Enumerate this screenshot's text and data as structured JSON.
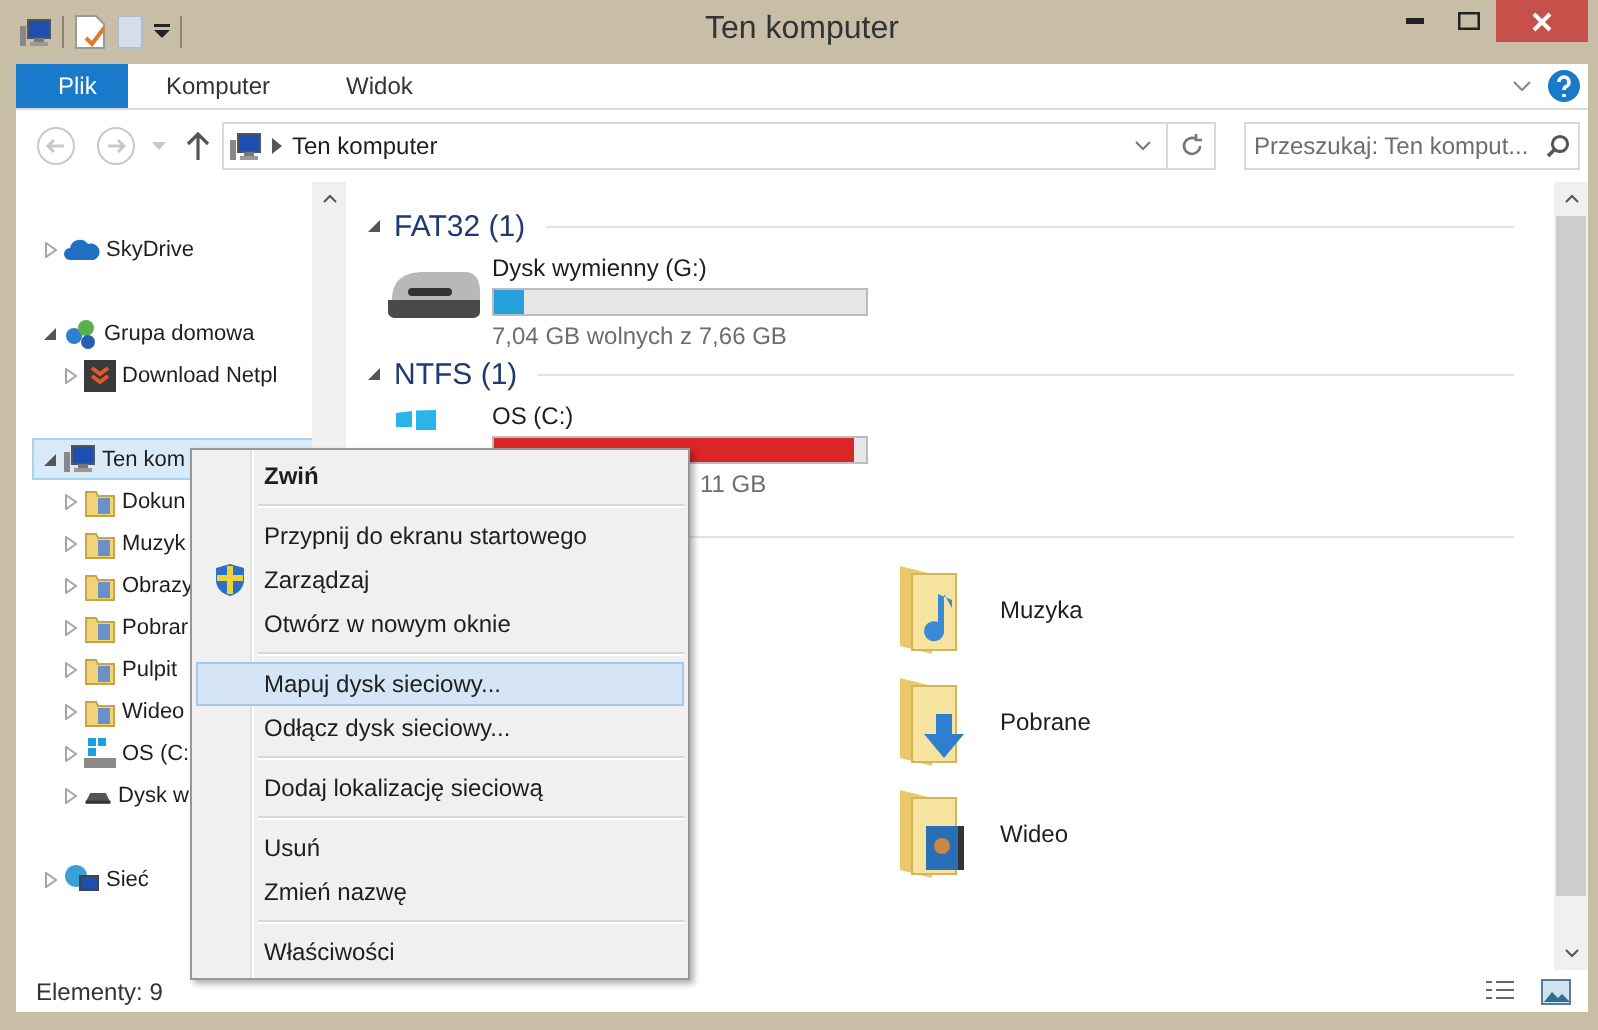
{
  "window": {
    "title": "Ten komputer"
  },
  "ribbon": {
    "tabs": [
      {
        "label": "Plik",
        "kind": "file",
        "selected": false
      },
      {
        "label": "Komputer",
        "kind": "tab",
        "selected": false
      },
      {
        "label": "Widok",
        "kind": "tab",
        "selected": false
      }
    ]
  },
  "address_bar": {
    "path": [
      "Ten komputer"
    ]
  },
  "search": {
    "placeholder": "Przeszukaj: Ten komput..."
  },
  "navigation": {
    "items": [
      {
        "label": "SkyDrive",
        "kind": "cloud",
        "expanded": false,
        "selected": false
      },
      {
        "label": "Grupa domowa",
        "kind": "homegroup",
        "expanded": true,
        "selected": false,
        "children": [
          {
            "label": "Download Netpl",
            "kind": "app",
            "expanded": false,
            "selected": false
          }
        ]
      },
      {
        "label": "Ten kom",
        "kind": "computer",
        "expanded": true,
        "selected": true,
        "children": [
          {
            "label": "Dokun",
            "kind": "folder",
            "expanded": false,
            "selected": false
          },
          {
            "label": "Muzyk",
            "kind": "folder",
            "expanded": false,
            "selected": false
          },
          {
            "label": "Obrazy",
            "kind": "folder",
            "expanded": false,
            "selected": false
          },
          {
            "label": "Pobrar",
            "kind": "folder",
            "expanded": false,
            "selected": false
          },
          {
            "label": "Pulpit",
            "kind": "folder",
            "expanded": false,
            "selected": false
          },
          {
            "label": "Wideo",
            "kind": "folder",
            "expanded": false,
            "selected": false
          },
          {
            "label": "OS (C:",
            "kind": "system",
            "expanded": false,
            "selected": false
          },
          {
            "label": "Dysk w",
            "kind": "removable",
            "expanded": false,
            "selected": false
          }
        ]
      },
      {
        "label": "Sieć",
        "kind": "network",
        "expanded": false,
        "selected": false
      }
    ]
  },
  "content": {
    "groups": [
      {
        "title": "FAT32 (1)",
        "expanded": true,
        "drives": [
          {
            "name": "Dysk wymienny (G:)",
            "kind": "removable",
            "level": 0.08,
            "free_space": "7,04 GB wolnych z 7,66 GB",
            "start_hidden": false
          }
        ]
      },
      {
        "title": "NTFS (1)",
        "expanded": true,
        "drives": [
          {
            "name": "OS (C:)",
            "kind": "system",
            "level": 0.97,
            "free_space": "11 GB",
            "start_hidden": true
          }
        ]
      }
    ],
    "folders": [
      {
        "name": "Muzyka",
        "kind": "music"
      },
      {
        "name": "Pobrane",
        "kind": "downloads"
      },
      {
        "name": "Wideo",
        "kind": "video"
      }
    ]
  },
  "context_menu": {
    "groups": [
      [
        {
          "label": "Zwiń",
          "default": true,
          "selected": false,
          "kind": "text"
        }
      ],
      [
        {
          "label": "Przypnij do ekranu startowego",
          "default": false,
          "selected": false,
          "kind": "text"
        },
        {
          "label": "Zarządzaj",
          "default": false,
          "selected": false,
          "kind": "shield"
        },
        {
          "label": "Otwórz w nowym oknie",
          "default": false,
          "selected": false,
          "kind": "text"
        }
      ],
      [
        {
          "label": "Mapuj dysk sieciowy...",
          "default": false,
          "selected": true,
          "kind": "text"
        },
        {
          "label": "Odłącz dysk sieciowy...",
          "default": false,
          "selected": false,
          "kind": "text"
        }
      ],
      [
        {
          "label": "Dodaj lokalizację sieciową",
          "default": false,
          "selected": false,
          "kind": "text"
        }
      ],
      [
        {
          "label": "Usuń",
          "default": false,
          "selected": false,
          "kind": "text"
        },
        {
          "label": "Zmień nazwę",
          "default": false,
          "selected": false,
          "kind": "text"
        }
      ],
      [
        {
          "label": "Właściwości",
          "default": false,
          "selected": false,
          "kind": "text"
        }
      ]
    ]
  },
  "status_bar": {
    "item_count": "Elementy: 9"
  }
}
